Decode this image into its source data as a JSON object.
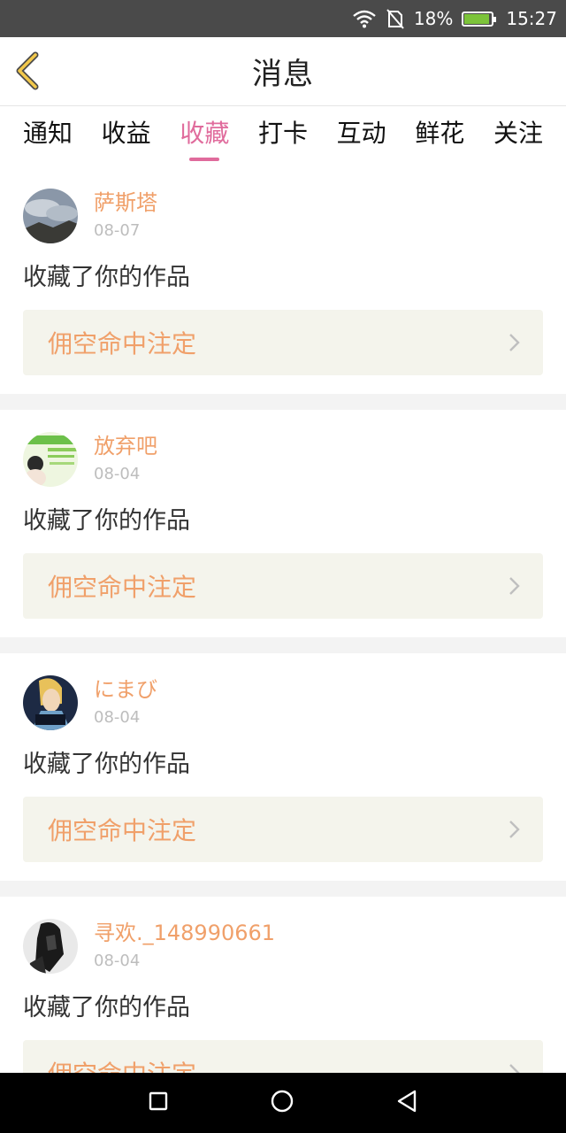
{
  "status_bar": {
    "battery": "18%",
    "time": "15:27"
  },
  "header": {
    "title": "消息"
  },
  "tabs": [
    {
      "label": "通知",
      "active": false
    },
    {
      "label": "收益",
      "active": false
    },
    {
      "label": "收藏",
      "active": true
    },
    {
      "label": "打卡",
      "active": false
    },
    {
      "label": "互动",
      "active": false
    },
    {
      "label": "鲜花",
      "active": false
    },
    {
      "label": "关注",
      "active": false
    }
  ],
  "items": [
    {
      "user": "萨斯塔",
      "date": "08-07",
      "action": "收藏了你的作品",
      "work": "佣空命中注定"
    },
    {
      "user": "放弃吧",
      "date": "08-04",
      "action": "收藏了你的作品",
      "work": "佣空命中注定"
    },
    {
      "user": "にまび",
      "date": "08-04",
      "action": "收藏了你的作品",
      "work": "佣空命中注定"
    },
    {
      "user": "寻欢._148990661",
      "date": "08-04",
      "action": "收藏了你的作品",
      "work": "佣空命中注定"
    }
  ],
  "colors": {
    "accent": "#e06b9c",
    "name": "#f0a06a",
    "work_bg": "#f4f4ec"
  }
}
